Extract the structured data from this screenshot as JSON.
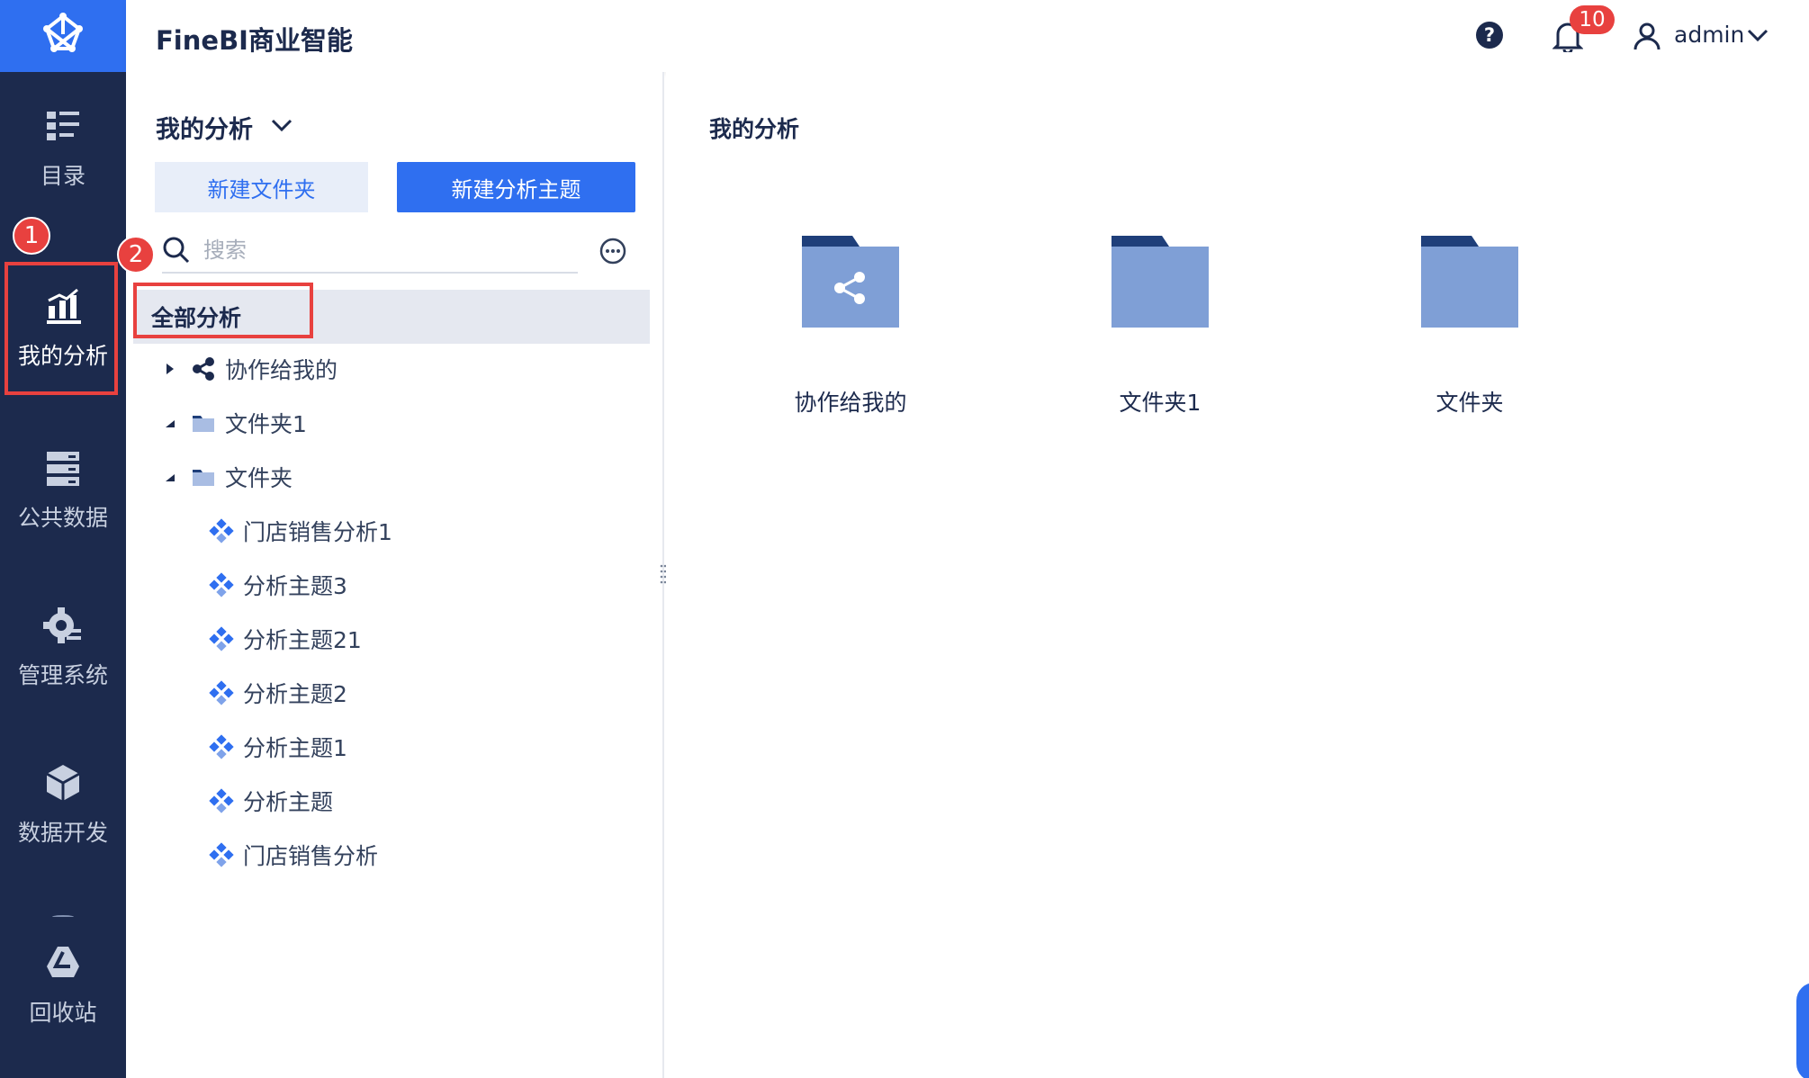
{
  "header": {
    "app_title": "FineBI商业智能",
    "help_label": "?",
    "notification_count": "10",
    "user_name": "admin"
  },
  "sidebar": {
    "items": [
      {
        "label": "目录",
        "icon": "catalog-icon"
      },
      {
        "label": "我的分析",
        "icon": "analysis-chart-icon",
        "active": true
      },
      {
        "label": "公共数据",
        "icon": "database-icon"
      },
      {
        "label": "管理系统",
        "icon": "gear-icon"
      },
      {
        "label": "数据开发",
        "icon": "cube-icon"
      },
      {
        "label": "回收站",
        "icon": "recycle-icon"
      }
    ],
    "annotation_badge": "1"
  },
  "panel": {
    "title": "我的分析",
    "new_folder_label": "新建文件夹",
    "new_topic_label": "新建分析主题",
    "search_placeholder": "搜索",
    "annotation_badge": "2",
    "all_label": "全部分析",
    "tree": [
      {
        "label": "协作给我的",
        "type": "share",
        "expanded": false
      },
      {
        "label": "文件夹1",
        "type": "folder",
        "expanded": true
      },
      {
        "label": "文件夹",
        "type": "folder",
        "expanded": true
      },
      {
        "label": "门店销售分析1",
        "type": "topic"
      },
      {
        "label": "分析主题3",
        "type": "topic"
      },
      {
        "label": "分析主题21",
        "type": "topic"
      },
      {
        "label": "分析主题2",
        "type": "topic"
      },
      {
        "label": "分析主题1",
        "type": "topic"
      },
      {
        "label": "分析主题",
        "type": "topic"
      },
      {
        "label": "门店销售分析",
        "type": "topic"
      }
    ]
  },
  "content": {
    "title": "我的分析",
    "tiles": [
      {
        "label": "协作给我的",
        "icon": "shared-folder-icon"
      },
      {
        "label": "文件夹1",
        "icon": "folder-icon"
      },
      {
        "label": "文件夹",
        "icon": "folder-icon"
      }
    ]
  },
  "colors": {
    "sidebar_bg": "#1c2a4d",
    "accent": "#2f6ff0",
    "folder": "#7f9fd6",
    "folder_tab": "#1f3f7a",
    "highlight_red": "#e8413f"
  }
}
